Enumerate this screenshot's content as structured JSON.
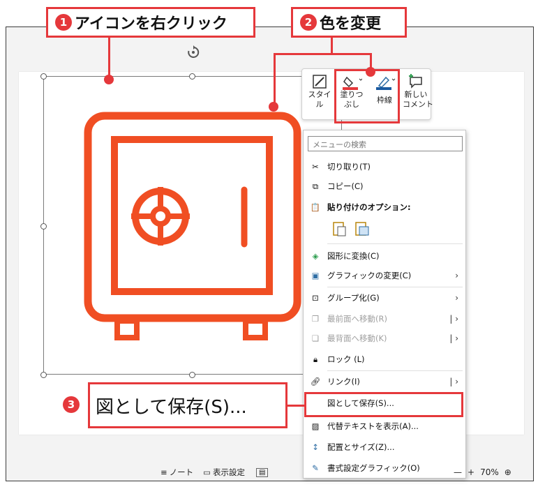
{
  "callouts": {
    "step1": {
      "num": "1",
      "label": "アイコンを右クリック"
    },
    "step2": {
      "num": "2",
      "label": "色を変更"
    },
    "step3": {
      "num": "3",
      "label": "図として保存(S)..."
    }
  },
  "mini_toolbar": {
    "style_label": "スタイ\nル",
    "fill_label": "塗りつ\nぶし",
    "outline_label": "枠線",
    "comment_label": "新しい\nコメント"
  },
  "context_menu": {
    "search_placeholder": "メニューの検索",
    "items": [
      {
        "label": "切り取り(T)",
        "icon": "scissors-icon"
      },
      {
        "label": "コピー(C)",
        "icon": "copy-icon"
      },
      {
        "label": "貼り付けのオプション:",
        "icon": "paste-icon"
      },
      {
        "label": "図形に変換(C)",
        "icon": "convert-shape-icon"
      },
      {
        "label": "グラフィックの変更(C)",
        "icon": "change-graphic-icon"
      },
      {
        "label": "グループ化(G)",
        "icon": "group-icon"
      },
      {
        "label": "最前面へ移動(R)",
        "icon": "bring-front-icon"
      },
      {
        "label": "最背面へ移動(K)",
        "icon": "send-back-icon"
      },
      {
        "label": "ロック (L)",
        "icon": "lock-icon"
      },
      {
        "label": "リンク(I)",
        "icon": "link-icon"
      },
      {
        "label": "図として保存(S)...",
        "icon": ""
      },
      {
        "label": "代替テキストを表示(A)...",
        "icon": "alt-text-icon"
      },
      {
        "label": "配置とサイズ(Z)...",
        "icon": "size-position-icon"
      },
      {
        "label": "書式設定グラフィック(O)",
        "icon": "format-graphic-icon"
      }
    ]
  },
  "status_bar": {
    "notes": "ノート",
    "display_settings": "表示設定",
    "zoom_minus": "—",
    "zoom_plus": "+",
    "zoom": "70%"
  },
  "colors": {
    "accent": "#e5383b",
    "icon": "#f04e23"
  }
}
